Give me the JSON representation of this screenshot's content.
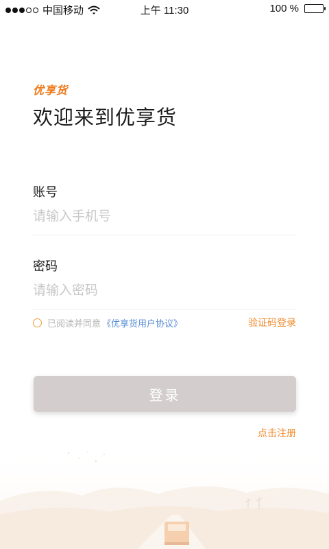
{
  "status_bar": {
    "carrier": "中国移动",
    "time": "上午 11:30",
    "battery": "100 %",
    "battery_level": 1.0
  },
  "header": {
    "brand": "优享货",
    "welcome": "欢迎来到优享货"
  },
  "form": {
    "account_label": "账号",
    "account_placeholder": "请输入手机号",
    "account_value": "",
    "password_label": "密码",
    "password_placeholder": "请输入密码",
    "password_value": ""
  },
  "agreement": {
    "checked": false,
    "prefix": "已阅读并同意",
    "link": "《优享货用户协议》"
  },
  "sms_login": "验证码登录",
  "login_button": "登录",
  "register": "点击注册",
  "colors": {
    "brand_orange": "#ef7b1e",
    "link_blue": "#5a8fd6",
    "button_disabled": "#d3cecd"
  }
}
